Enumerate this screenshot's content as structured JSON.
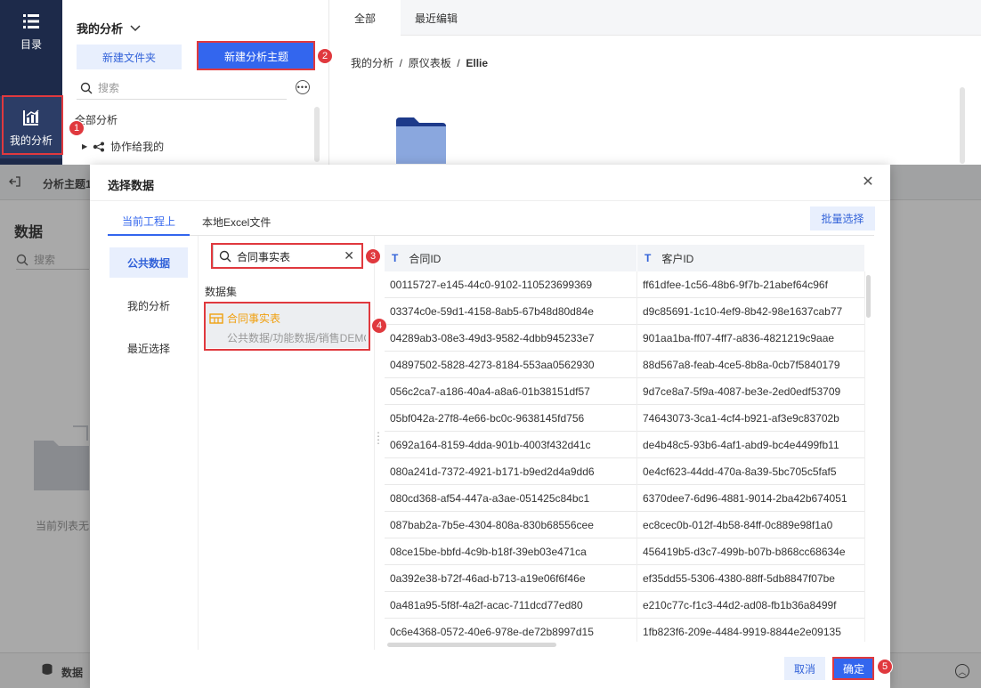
{
  "nav": {
    "catalog_label": "目录",
    "my_analysis_label": "我的分析"
  },
  "panel": {
    "title": "我的分析",
    "new_folder": "新建文件夹",
    "new_topic": "新建分析主题",
    "search_placeholder": "搜索",
    "tree_all": "全部分析",
    "tree_shared": "协作给我的"
  },
  "main": {
    "tabs": [
      "全部",
      "最近编辑"
    ],
    "breadcrumb": [
      "我的分析",
      "原仪表板",
      "Ellie"
    ]
  },
  "underlay": {
    "topbar_title": "分析主题1",
    "data_title": "数据",
    "search_placeholder": "搜索",
    "empty_text": "当前列表无",
    "footer_label": "数据"
  },
  "modal": {
    "title": "选择数据",
    "tabs": [
      "当前工程上",
      "本地Excel文件"
    ],
    "batch_select": "批量选择",
    "categories": [
      "公共数据",
      "我的分析",
      "最近选择"
    ],
    "search_value": "合同事实表",
    "dataset_label": "数据集",
    "dataset": {
      "name": "合同事实表",
      "path": "公共数据/功能数据/销售DEMO"
    },
    "columns": [
      "合同ID",
      "客户ID"
    ],
    "rows": [
      [
        "00115727-e145-44c0-9102-110523699369",
        "ff61dfee-1c56-48b6-9f7b-21abef64c96f"
      ],
      [
        "03374c0e-59d1-4158-8ab5-67b48d80d84e",
        "d9c85691-1c10-4ef9-8b42-98e1637cab77"
      ],
      [
        "04289ab3-08e3-49d3-9582-4dbb945233e7",
        "901aa1ba-ff07-4ff7-a836-4821219c9aae"
      ],
      [
        "04897502-5828-4273-8184-553aa0562930",
        "88d567a8-feab-4ce5-8b8a-0cb7f5840179"
      ],
      [
        "056c2ca7-a186-40a4-a8a6-01b38151df57",
        "9d7ce8a7-5f9a-4087-be3e-2ed0edf53709"
      ],
      [
        "05bf042a-27f8-4e66-bc0c-9638145fd756",
        "74643073-3ca1-4cf4-b921-af3e9c83702b"
      ],
      [
        "0692a164-8159-4dda-901b-4003f432d41c",
        "de4b48c5-93b6-4af1-abd9-bc4e4499fb11"
      ],
      [
        "080a241d-7372-4921-b171-b9ed2d4a9dd6",
        "0e4cf623-44dd-470a-8a39-5bc705c5faf5"
      ],
      [
        "080cd368-af54-447a-a3ae-051425c84bc1",
        "6370dee7-6d96-4881-9014-2ba42b674051"
      ],
      [
        "087bab2a-7b5e-4304-808a-830b68556cee",
        "ec8cec0b-012f-4b58-84ff-0c889e98f1a0"
      ],
      [
        "08ce15be-bbfd-4c9b-b18f-39eb03e471ca",
        "456419b5-d3c7-499b-b07b-b868cc68634e"
      ],
      [
        "0a392e38-b72f-46ad-b713-a19e06f6f46e",
        "ef35dd55-5306-4380-88ff-5db8847f07be"
      ],
      [
        "0a481a95-5f8f-4a2f-acac-711dcd77ed80",
        "e210c77c-f1c3-44d2-ad08-fb1b36a8499f"
      ],
      [
        "0c6e4368-0572-40e6-978e-de72b8997d15",
        "1fb823f6-209e-4484-9919-8844e2e09135"
      ]
    ],
    "cancel": "取消",
    "confirm": "确定"
  },
  "annotations": [
    "1",
    "2",
    "3",
    "4",
    "5"
  ],
  "colors": {
    "accent": "#3366ee",
    "nav_bg": "#1d2a4a",
    "annotation": "#e0393e",
    "dataset_name": "#f0a010"
  }
}
